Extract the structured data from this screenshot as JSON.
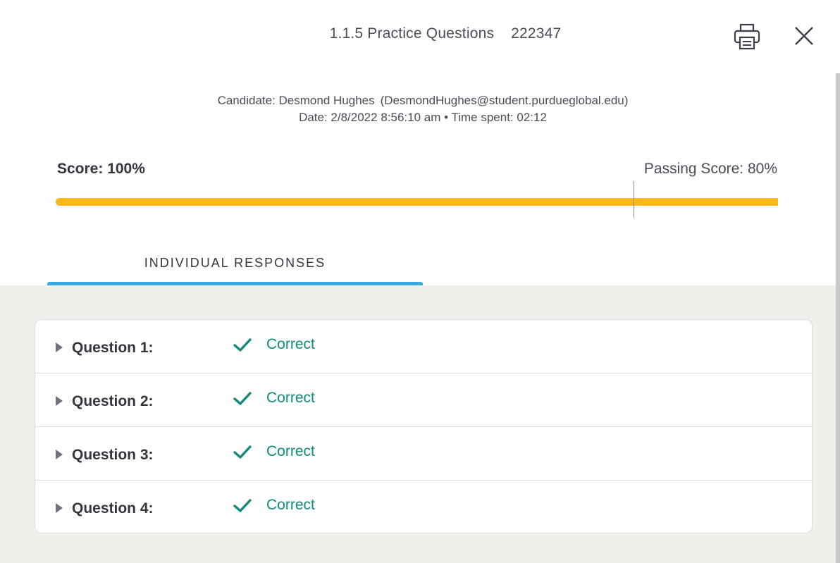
{
  "header": {
    "title": "1.1.5 Practice Questions",
    "code": "222347",
    "print_icon": "printer-icon",
    "close_icon": "close-icon"
  },
  "candidate": {
    "line1_prefix": "Candidate: Desmond Hughes",
    "email": "(DesmondHughes@student.purdueglobal.edu)",
    "line2": "Date: 2/8/2022 8:56:10 am • Time spent: 02:12"
  },
  "score": {
    "label": "Score: 100%",
    "passing_label": "Passing Score: 80%",
    "score_fraction": 1.0,
    "passing_fraction": 0.8,
    "bar_color": "#fbb917"
  },
  "tabs": [
    {
      "label": "INDIVIDUAL RESPONSES",
      "active": true,
      "accent": "#3aa9e0"
    }
  ],
  "questions": [
    {
      "label": "Question 1:",
      "result": "Correct",
      "icon": "checkmark-icon"
    },
    {
      "label": "Question 2:",
      "result": "Correct",
      "icon": "checkmark-icon"
    },
    {
      "label": "Question 3:",
      "result": "Correct",
      "icon": "checkmark-icon"
    },
    {
      "label": "Question 4:",
      "result": "Correct",
      "icon": "checkmark-icon"
    }
  ],
  "colors": {
    "correct": "#118a7a",
    "panel_bg": "#f0efec"
  }
}
